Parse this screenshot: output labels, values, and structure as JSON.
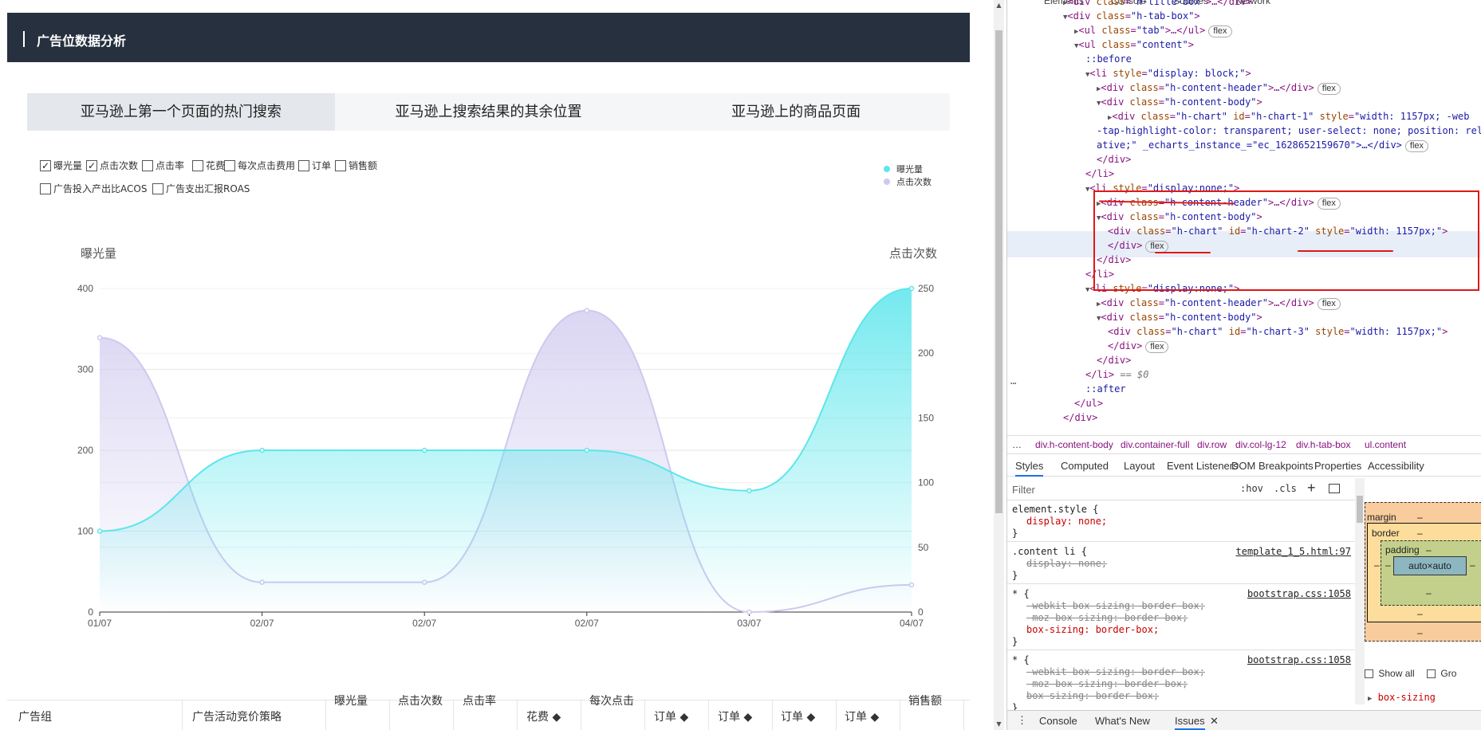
{
  "page": {
    "title": "广告位数据分析",
    "tabs": [
      "亚马逊上第一个页面的热门搜索",
      "亚马逊上搜索结果的其余位置",
      "亚马逊上的商品页面"
    ],
    "active_tab": 0,
    "checkboxes": [
      {
        "label": "曝光量",
        "checked": true
      },
      {
        "label": "点击次数",
        "checked": true
      },
      {
        "label": "点击率",
        "checked": false
      },
      {
        "label": "花费",
        "checked": false
      },
      {
        "label": "每次点击费用",
        "checked": false
      },
      {
        "label": "订单",
        "checked": false
      },
      {
        "label": "销售额",
        "checked": false
      },
      {
        "label": "广告投入产出比ACOS",
        "checked": false
      },
      {
        "label": "广告支出汇报ROAS",
        "checked": false
      }
    ],
    "table_headers": [
      "广告组",
      "广告活动竞价策略",
      "曝光量",
      "点击次数",
      "点击率",
      "花费 ◆",
      "每次点击",
      "订单 ◆",
      "订单 ◆",
      "订单 ◆",
      "订单 ◆",
      "销售额"
    ]
  },
  "chart_data": {
    "type": "line",
    "categories": [
      "01/07",
      "02/07",
      "02/07",
      "02/07",
      "03/07",
      "04/07"
    ],
    "series": [
      {
        "name": "曝光量",
        "axis": "left",
        "values": [
          100,
          200,
          200,
          200,
          150,
          400
        ],
        "color": "#5ce6ec"
      },
      {
        "name": "点击次数",
        "axis": "right",
        "values": [
          212,
          23,
          23,
          233,
          0,
          21
        ],
        "color": "#cfc8ee"
      }
    ],
    "ylabel_left": "曝光量",
    "ylabel_right": "点击次数",
    "ylim_left": [
      0,
      400
    ],
    "yticks_left": [
      0,
      100,
      200,
      300,
      400
    ],
    "ylim_right": [
      0,
      250
    ],
    "yticks_right": [
      0,
      50,
      100,
      150,
      200,
      250
    ],
    "legend_position": "top-right",
    "smooth": true,
    "area": true
  },
  "devtools": {
    "top_tabs": [
      "Elements",
      "Console",
      "Sources",
      "Network"
    ],
    "dom_lines": [
      {
        "indent": 0,
        "tri": "▶",
        "tag": "div",
        "cls": "h-title-box",
        "rest": ">…</div>"
      },
      {
        "indent": 0,
        "tri": "▼",
        "tag": "div",
        "cls": "h-tab-box",
        "rest": ">"
      },
      {
        "indent": 1,
        "tri": "▶",
        "tag": "ul",
        "cls": "tab",
        "rest": ">…</ul>",
        "flex": true
      },
      {
        "indent": 1,
        "tri": "▼",
        "tag": "ul",
        "cls": "content",
        "rest": ">"
      },
      {
        "indent": 2,
        "pseudo": "::before"
      },
      {
        "indent": 2,
        "tri": "▼",
        "tag": "li",
        "style": "display: block;",
        "rest": ">"
      },
      {
        "indent": 3,
        "tri": "▶",
        "tag": "div",
        "cls": "h-content-header",
        "rest": ">…</div>",
        "flex": true
      },
      {
        "indent": 3,
        "tri": "▼",
        "tag": "div",
        "cls": "h-content-body",
        "rest": ">"
      },
      {
        "indent": 4,
        "tri": "▶",
        "tag": "div",
        "cls": "h-chart",
        "id": "h-chart-1",
        "style": "width: 1157px; -web"
      },
      {
        "indent": 3,
        "raw": "-tap-highlight-color: transparent; user-select: none; position: rel"
      },
      {
        "indent": 3,
        "raw": "ative;\" _echarts_instance_=\"ec_1628652159670\">…</div>",
        "flex": true
      },
      {
        "indent": 3,
        "close": "</div>"
      },
      {
        "indent": 2,
        "close": "</li>"
      },
      {
        "indent": 2,
        "tri": "▼",
        "tag": "li",
        "style": "display:none;",
        "rest": ">"
      },
      {
        "indent": 3,
        "tri": "▶",
        "tag": "div",
        "cls": "h-content-header",
        "rest": ">…</div>",
        "flex": true
      },
      {
        "indent": 3,
        "tri": "▼",
        "tag": "div",
        "cls": "h-content-body",
        "rest": ">"
      },
      {
        "indent": 4,
        "tag": "div",
        "cls": "h-chart",
        "id": "h-chart-2",
        "style": "width: 1157px;",
        "rest": ">"
      },
      {
        "indent": 4,
        "close": "</div>",
        "flex": true
      },
      {
        "indent": 3,
        "close": "</div>"
      },
      {
        "indent": 2,
        "close": "</li>"
      },
      {
        "indent": 2,
        "tri": "▼",
        "tag": "li",
        "style": "display:none;",
        "rest": ">"
      },
      {
        "indent": 3,
        "tri": "▶",
        "tag": "div",
        "cls": "h-content-header",
        "rest": ">…</div>",
        "flex": true
      },
      {
        "indent": 3,
        "tri": "▼",
        "tag": "div",
        "cls": "h-content-body",
        "rest": ">"
      },
      {
        "indent": 4,
        "tag": "div",
        "cls": "h-chart",
        "id": "h-chart-3",
        "style": "width: 1157px;",
        "rest": ">"
      },
      {
        "indent": 4,
        "close": "</div>",
        "flex": true
      },
      {
        "indent": 3,
        "close": "</div>"
      },
      {
        "indent": 2,
        "close": "</li>",
        "note": " == $0"
      },
      {
        "indent": 2,
        "pseudo": "::after"
      },
      {
        "indent": 1,
        "close": "</ul>"
      },
      {
        "indent": 0,
        "close": "</div>"
      }
    ],
    "breadcrumbs": [
      "…",
      "div.h-content-body",
      "div.container-full",
      "div.row",
      "div.col-lg-12",
      "div.h-tab-box",
      "ul.content"
    ],
    "sub_tabs": [
      "Styles",
      "Computed",
      "Layout",
      "Event Listeners",
      "DOM Breakpoints",
      "Properties",
      "Accessibility"
    ],
    "filter_placeholder": "Filter",
    "hov": ":hov",
    "cls": ".cls",
    "css_rules": [
      {
        "selector": "element.style {",
        "decls": [
          {
            "text": "display: none;",
            "strike": false
          }
        ],
        "src": ""
      },
      {
        "selector": ".content li {",
        "decls": [
          {
            "text": "display: none;",
            "strike": true
          }
        ],
        "src": "template_1_5.html:97"
      },
      {
        "selector": "* {",
        "decls": [
          {
            "text": "-webkit-box-sizing: border-box;",
            "strike": true
          },
          {
            "text": "-moz-box-sizing: border-box;",
            "strike": true
          },
          {
            "text": "box-sizing: border-box;",
            "strike": false
          }
        ],
        "src": "bootstrap.css:1058"
      },
      {
        "selector": "* {",
        "decls": [
          {
            "text": "-webkit-box-sizing: border-box;",
            "strike": true
          },
          {
            "text": "-moz-box-sizing: border-box;",
            "strike": true
          },
          {
            "text": "box-sizing: border-box;",
            "strike": true
          }
        ],
        "src": "bootstrap.css:1058"
      }
    ],
    "box_model": {
      "margin": "margin",
      "border": "border",
      "padding": "padding",
      "content": "auto×auto",
      "dash": "–"
    },
    "show_all": "Show all",
    "group": "Gro",
    "box_sizing_prop": "box-sizing",
    "drawer_tabs": [
      "Console",
      "What's New",
      "Issues"
    ]
  }
}
